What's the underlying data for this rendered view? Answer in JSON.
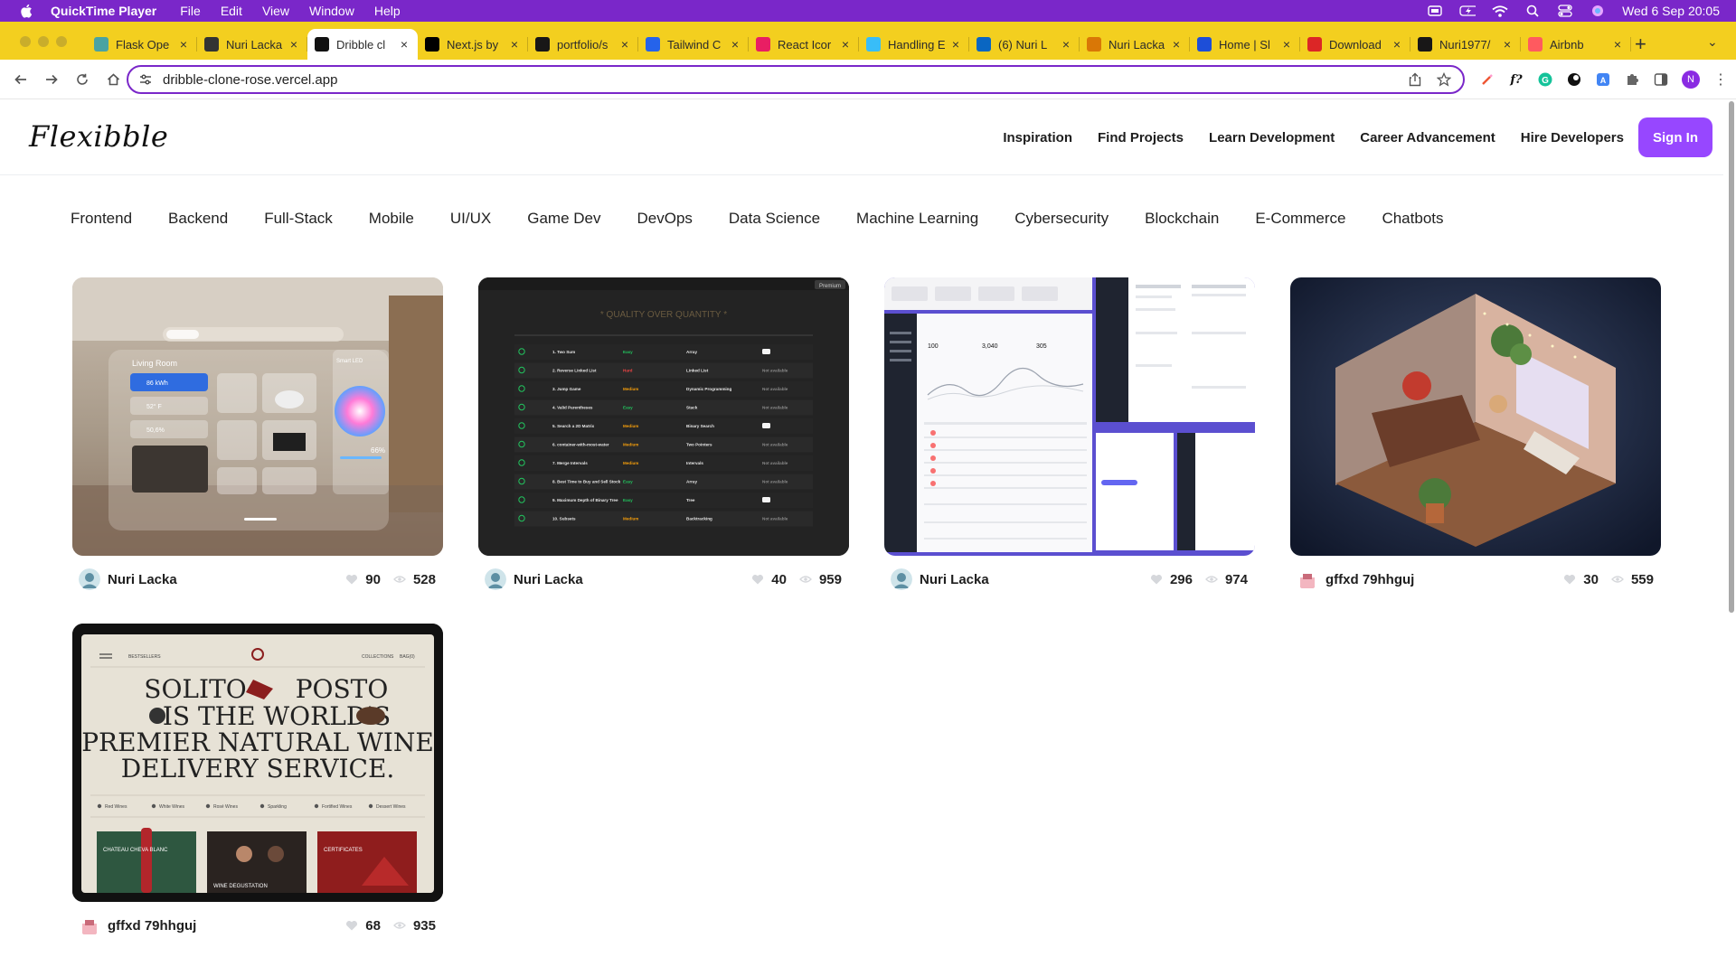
{
  "menubar": {
    "app_name": "QuickTime Player",
    "items": [
      "File",
      "Edit",
      "View",
      "Window",
      "Help"
    ],
    "clock": "Wed 6 Sep  20:05"
  },
  "tabs": [
    {
      "title": "Flask Ope",
      "favicon_color": "#4aa3a2"
    },
    {
      "title": "Nuri Lacka",
      "favicon_color": "#333333"
    },
    {
      "title": "Dribble cl",
      "favicon_color": "#111111"
    },
    {
      "title": "Next.js by",
      "favicon_color": "#000000"
    },
    {
      "title": "portfolio/s",
      "favicon_color": "#181717"
    },
    {
      "title": "Tailwind C",
      "favicon_color": "#2563eb"
    },
    {
      "title": "React Icor",
      "favicon_color": "#e91e63"
    },
    {
      "title": "Handling E",
      "favicon_color": "#38bdf8"
    },
    {
      "title": "(6) Nuri L",
      "favicon_color": "#0a66c2"
    },
    {
      "title": "Nuri Lacka",
      "favicon_color": "#d97706"
    },
    {
      "title": "Home | Sl",
      "favicon_color": "#1d4ed8"
    },
    {
      "title": "Download",
      "favicon_color": "#dc2626"
    },
    {
      "title": "Nuri1977/",
      "favicon_color": "#181717"
    },
    {
      "title": "Airbnb",
      "favicon_color": "#ff5a5f"
    }
  ],
  "active_tab_index": 2,
  "address_bar": {
    "url": "dribble-clone-rose.vercel.app"
  },
  "site": {
    "logo": "Flexibble",
    "nav": [
      "Inspiration",
      "Find Projects",
      "Learn Development",
      "Career Advancement",
      "Hire Developers"
    ],
    "sign_in": "Sign In",
    "accent": "#9747ff"
  },
  "categories": [
    "Frontend",
    "Backend",
    "Full-Stack",
    "Mobile",
    "UI/UX",
    "Game Dev",
    "DevOps",
    "Data Science",
    "Machine Learning",
    "Cybersecurity",
    "Blockchain",
    "E-Commerce",
    "Chatbots"
  ],
  "projects": [
    {
      "author": "Nuri Lacka",
      "likes": "90",
      "views": "528"
    },
    {
      "author": "Nuri Lacka",
      "likes": "40",
      "views": "959"
    },
    {
      "author": "Nuri Lacka",
      "likes": "296",
      "views": "974"
    },
    {
      "author": "gffxd 79hhguj",
      "likes": "30",
      "views": "559"
    },
    {
      "author": "gffxd 79hhguj",
      "likes": "68",
      "views": "935"
    }
  ],
  "thumb_texts": {
    "living_room": "Living Room",
    "energy": "86 kWh",
    "temp": "52° F",
    "humidity": "50,6%",
    "led": "Smart LED",
    "led_level": "66%",
    "quality_title": "* QUALITY OVER QUANTITY *",
    "premium": "Premium",
    "problems": [
      {
        "name": "1. Two Sum",
        "level": "Easy",
        "topic": "Array",
        "status": "video"
      },
      {
        "name": "2. Reverse Linked List",
        "level": "Hard",
        "topic": "Linked List",
        "status": "Not available"
      },
      {
        "name": "3. Jump Game",
        "level": "Medium",
        "topic": "Dynamic Programming",
        "status": "Not available"
      },
      {
        "name": "4. Valid Parentheses",
        "level": "Easy",
        "topic": "Stack",
        "status": "Not available"
      },
      {
        "name": "5. Search a 2D Matrix",
        "level": "Medium",
        "topic": "Binary Search",
        "status": "video"
      },
      {
        "name": "6. container-with-most-water",
        "level": "Medium",
        "topic": "Two Pointers",
        "status": "Not available"
      },
      {
        "name": "7. Merge Intervals",
        "level": "Medium",
        "topic": "Intervals",
        "status": "Not available"
      },
      {
        "name": "8. Best Time to Buy and Sell Stock",
        "level": "Easy",
        "topic": "Array",
        "status": "Not available"
      },
      {
        "name": "9. Maximum Depth of Binary Tree",
        "level": "Easy",
        "topic": "Tree",
        "status": "video"
      },
      {
        "name": "10. Subsets",
        "level": "Medium",
        "topic": "Backtracking",
        "status": "Not available"
      }
    ],
    "dashboard_stats": [
      "100",
      "3,040",
      "305"
    ],
    "wine_line1": "SOLITO",
    "wine_line1b": "POSTO",
    "wine_line2": "IS THE WORLD'S",
    "wine_line3": "PREMIER NATURAL WINE",
    "wine_line4": "DELIVERY SERVICE.",
    "wine_top_left": "BESTSELLERS",
    "wine_top_right1": "COLLECTIONS",
    "wine_top_right2": "BAG(0)",
    "wine_filters": [
      "Red Wines",
      "White Wines",
      "Rosé Wines",
      "Sparkling",
      "Fortified Wines",
      "Dessert Wines"
    ],
    "wine_card1": "CHATEAU CHEVA BLANC",
    "wine_card2": "WINE DEGUSTATION",
    "wine_card3": "CERTIFICATES"
  }
}
